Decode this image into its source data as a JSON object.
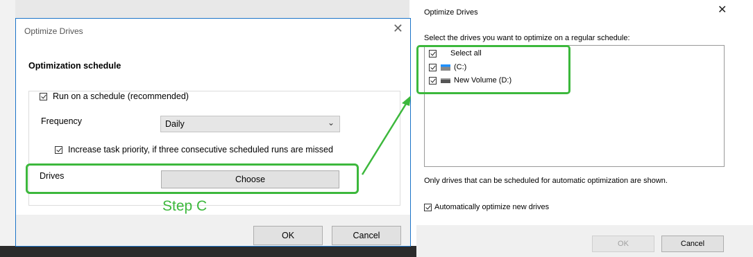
{
  "left_dialog": {
    "title": "Optimize Drives",
    "heading": "Optimization schedule",
    "run_on_schedule_label": "Run on a schedule (recommended)",
    "run_on_schedule_checked": true,
    "frequency_label": "Frequency",
    "frequency_value": "Daily",
    "priority_label": "Increase task priority, if three consecutive scheduled runs are missed",
    "priority_checked": true,
    "drives_label": "Drives",
    "choose_label": "Choose",
    "ok_label": "OK",
    "cancel_label": "Cancel"
  },
  "annotation": {
    "step_label": "Step C",
    "highlight_color": "#3cb83c"
  },
  "right_dialog": {
    "title": "Optimize Drives",
    "prompt": "Select the drives you want to optimize on a regular schedule:",
    "items": [
      {
        "label": "Select all",
        "checked": true,
        "icon": "none"
      },
      {
        "label": "(C:)",
        "checked": true,
        "icon": "system-drive-icon"
      },
      {
        "label": "New Volume (D:)",
        "checked": true,
        "icon": "drive-icon"
      }
    ],
    "note": "Only drives that can be scheduled for automatic optimization are shown.",
    "auto_optimize_label": "Automatically optimize new drives",
    "auto_optimize_checked": true,
    "ok_label": "OK",
    "ok_enabled": false,
    "cancel_label": "Cancel"
  }
}
